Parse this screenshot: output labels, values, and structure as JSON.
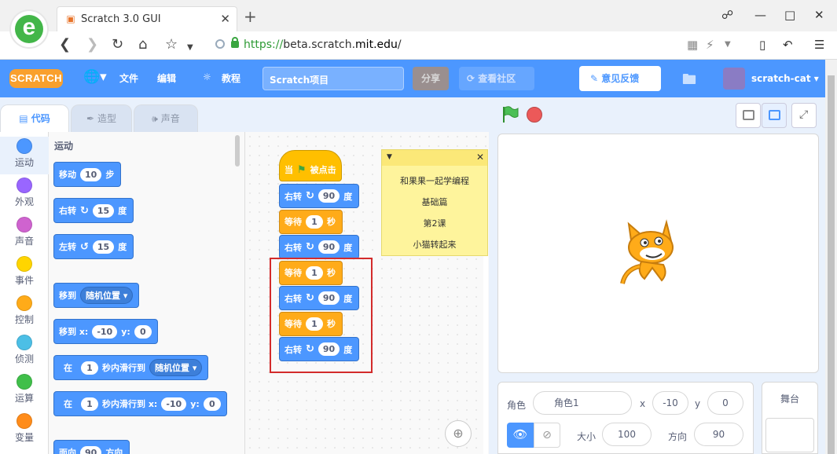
{
  "browser": {
    "tab_title": "Scratch 3.0 GUI",
    "url_scheme": "https://",
    "url_host_pre": "beta.scratch.",
    "url_host_main": "mit.edu",
    "url_path": "/"
  },
  "menu": {
    "logo": "SCRATCH",
    "file": "文件",
    "edit": "编辑",
    "tutorials": "教程",
    "project_name": "Scratch项目",
    "share": "分享",
    "community": "查看社区",
    "feedback": "意见反馈",
    "username": "scratch-cat"
  },
  "editor_tabs": {
    "code": "代码",
    "costumes": "造型",
    "sounds": "声音"
  },
  "categories": [
    {
      "label": "运动",
      "color": "#4c97ff"
    },
    {
      "label": "外观",
      "color": "#9966ff"
    },
    {
      "label": "声音",
      "color": "#cf63cf"
    },
    {
      "label": "事件",
      "color": "#ffd500"
    },
    {
      "label": "控制",
      "color": "#ffab19"
    },
    {
      "label": "侦测",
      "color": "#4cbfe6"
    },
    {
      "label": "运算",
      "color": "#40bf4a"
    },
    {
      "label": "变量",
      "color": "#ff8c1a"
    }
  ],
  "palette": {
    "title": "运动",
    "move": {
      "a": "移动",
      "v": "10",
      "b": "步"
    },
    "turn_right": {
      "a": "右转",
      "v": "15",
      "b": "度"
    },
    "turn_left": {
      "a": "左转",
      "v": "15",
      "b": "度"
    },
    "goto": {
      "a": "移到",
      "dd": "随机位置"
    },
    "goto_xy": {
      "a": "移到 x:",
      "x": "-10",
      "b": "y:",
      "y": "0"
    },
    "glide": {
      "a": "在",
      "v": "1",
      "b": "秒内滑行到",
      "dd": "随机位置"
    },
    "glide_xy": {
      "a": "在",
      "v": "1",
      "b": "秒内滑行到 x:",
      "x": "-10",
      "c": "y:",
      "y": "0"
    },
    "point": {
      "a": "面向",
      "v": "90",
      "b": "方向"
    }
  },
  "script": {
    "hat": {
      "a": "当",
      "b": "被点击"
    },
    "blocks": [
      {
        "type": "motion",
        "a": "右转",
        "v": "90",
        "b": "度"
      },
      {
        "type": "control",
        "a": "等待",
        "v": "1",
        "b": "秒"
      },
      {
        "type": "motion",
        "a": "右转",
        "v": "90",
        "b": "度"
      },
      {
        "type": "control",
        "a": "等待",
        "v": "1",
        "b": "秒"
      },
      {
        "type": "motion",
        "a": "右转",
        "v": "90",
        "b": "度"
      },
      {
        "type": "control",
        "a": "等待",
        "v": "1",
        "b": "秒"
      },
      {
        "type": "motion",
        "a": "右转",
        "v": "90",
        "b": "度"
      }
    ]
  },
  "comment": {
    "lines": [
      "和果果一起学编程",
      "基础篇",
      "第2课",
      "小猫转起来"
    ]
  },
  "sprite": {
    "label_sprite": "角色",
    "name": "角色1",
    "label_x": "x",
    "x": "-10",
    "label_y": "y",
    "y": "0",
    "label_size": "大小",
    "size": "100",
    "label_direction": "方向",
    "direction": "90"
  },
  "stage_panel": {
    "title": "舞台"
  },
  "colors": {
    "menu": "#4c97ff",
    "motion": "#4c97ff",
    "control": "#ffab19",
    "event": "#ffbf00",
    "highlight": "#d32b2b"
  }
}
